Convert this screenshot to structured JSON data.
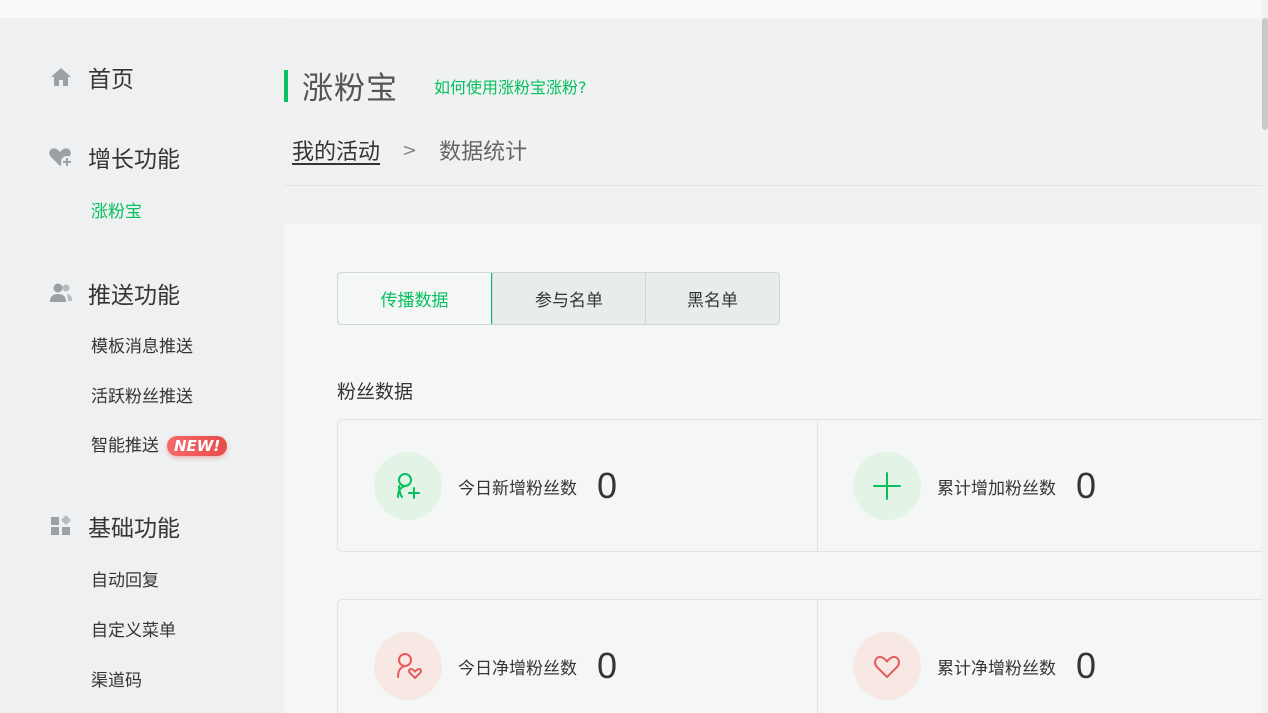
{
  "sidebar": {
    "home": {
      "label": "首页",
      "icon": "home-icon"
    },
    "groups": [
      {
        "label": "增长功能",
        "icon": "heart-plus-icon",
        "items": [
          {
            "label": "涨粉宝",
            "active": true
          }
        ]
      },
      {
        "label": "推送功能",
        "icon": "users-icon",
        "items": [
          {
            "label": "模板消息推送"
          },
          {
            "label": "活跃粉丝推送"
          },
          {
            "label": "智能推送",
            "badge": "NEW!"
          }
        ]
      },
      {
        "label": "基础功能",
        "icon": "grid-icon",
        "items": [
          {
            "label": "自动回复"
          },
          {
            "label": "自定义菜单"
          },
          {
            "label": "渠道码"
          }
        ]
      }
    ]
  },
  "header": {
    "title": "涨粉宝",
    "help_link": "如何使用涨粉宝涨粉?"
  },
  "breadcrumb": {
    "parent": "我的活动",
    "separator": ">",
    "current": "数据统计"
  },
  "tabs": [
    {
      "label": "传播数据",
      "active": true
    },
    {
      "label": "参与名单"
    },
    {
      "label": "黑名单"
    }
  ],
  "section_title": "粉丝数据",
  "stats": [
    {
      "label": "今日新增粉丝数",
      "value": "0",
      "icon": "user-plus-icon"
    },
    {
      "label": "累计增加粉丝数",
      "value": "0",
      "icon": "plus-icon"
    },
    {
      "label": "今日净增粉丝数",
      "value": "0",
      "icon": "user-heart-icon"
    },
    {
      "label": "累计净增粉丝数",
      "value": "0",
      "icon": "heart-icon"
    }
  ],
  "colors": {
    "accent": "#07c160",
    "badge": "#e84b4b",
    "pink_icon": "#e45c5c"
  }
}
